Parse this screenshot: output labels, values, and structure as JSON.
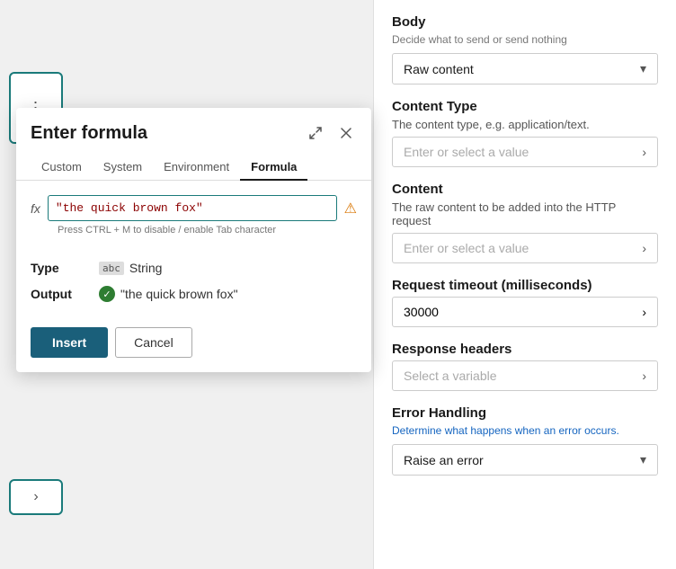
{
  "dialog": {
    "title": "Enter formula",
    "tabs": [
      "Custom",
      "System",
      "Environment",
      "Formula"
    ],
    "active_tab": "Formula",
    "formula_value": "\"the quick brown fox\"",
    "fx_label": "fx",
    "hint": "Press CTRL + M to disable / enable Tab character",
    "type_label": "Type",
    "type_value": "String",
    "output_label": "Output",
    "output_value": "\"the quick brown fox\"",
    "insert_button": "Insert",
    "cancel_button": "Cancel"
  },
  "right_panel": {
    "body": {
      "title": "Body",
      "subtitle": "Decide what to send or send nothing",
      "selected": "Raw content",
      "chevron": "▾"
    },
    "content_type": {
      "title": "Content Type",
      "subtitle": "The content type, e.g. application/text.",
      "placeholder": "Enter or select a value",
      "arrow": "›"
    },
    "content": {
      "title": "Content",
      "subtitle": "The raw content to be added into the HTTP request",
      "placeholder": "Enter or select a value",
      "arrow": "›"
    },
    "request_timeout": {
      "title": "Request timeout (milliseconds)",
      "value": "30000",
      "arrow": "›"
    },
    "response_headers": {
      "title": "Response headers",
      "placeholder": "Select a variable",
      "arrow": "›"
    },
    "error_handling": {
      "title": "Error Handling",
      "subtitle": "Determine what happens when an error occurs.",
      "selected": "Raise an error",
      "chevron": "▾"
    }
  }
}
